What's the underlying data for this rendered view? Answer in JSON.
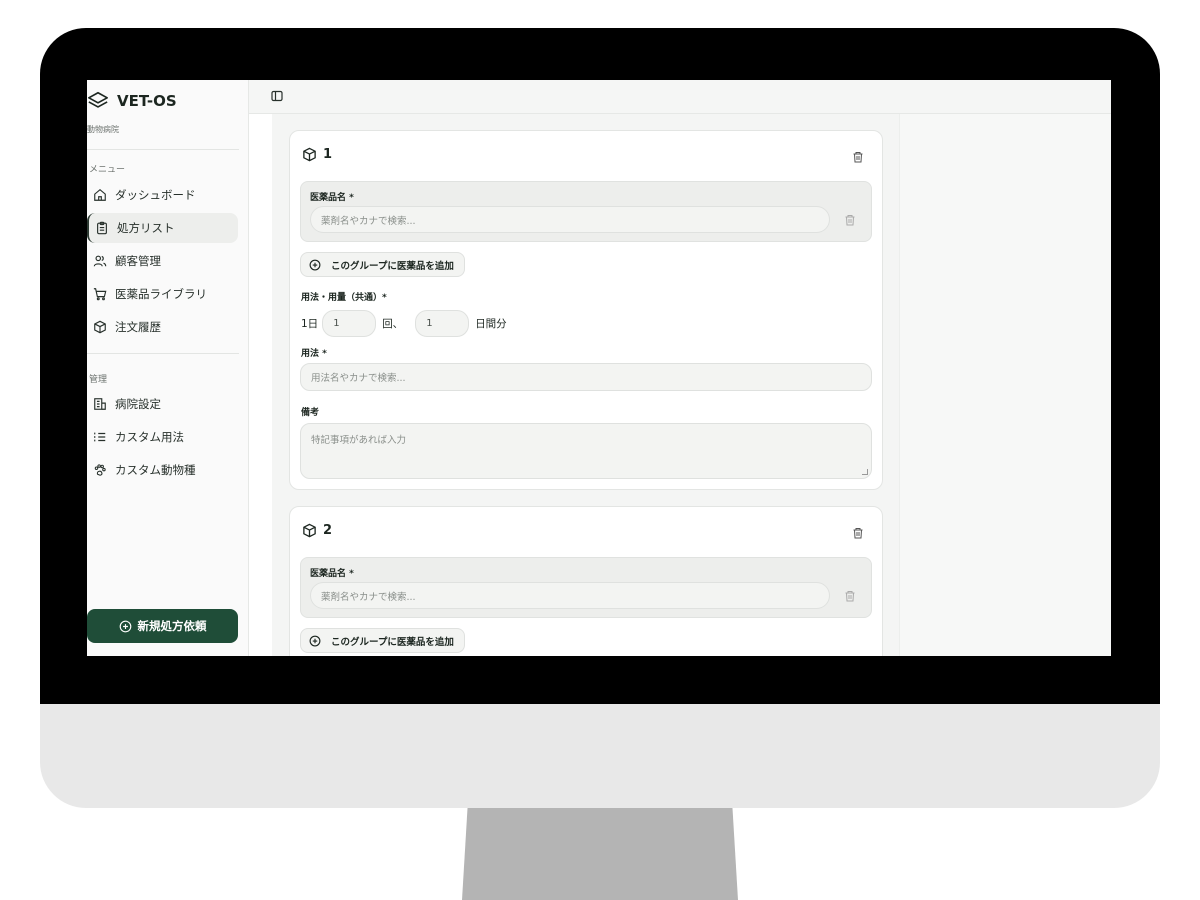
{
  "brand": {
    "name": "VET-OS",
    "subtitle": "動物病院"
  },
  "sidebar": {
    "menu_label": "メニュー",
    "items": [
      {
        "label": "ダッシュボード",
        "icon": "home-icon"
      },
      {
        "label": "処方リスト",
        "icon": "clipboard-icon",
        "active": true
      },
      {
        "label": "顧客管理",
        "icon": "users-icon"
      },
      {
        "label": "医薬品ライブラリ",
        "icon": "cart-icon"
      },
      {
        "label": "注文履歴",
        "icon": "package-icon"
      }
    ],
    "admin_label": "管理",
    "admin_items": [
      {
        "label": "病院設定",
        "icon": "building-icon"
      },
      {
        "label": "カスタム用法",
        "icon": "list-icon"
      },
      {
        "label": "カスタム動物種",
        "icon": "paw-icon"
      }
    ],
    "new_button": "新規処方依頼"
  },
  "groups": [
    {
      "number": "1",
      "med_label": "医薬品名 *",
      "med_placeholder": "薬剤名やカナで検索...",
      "add_label": "このグループに医薬品を追加",
      "dose_label": "用法・用量（共通）*",
      "dose": {
        "prefix": "1日",
        "times": "1",
        "times_unit": "回、",
        "days": "1",
        "days_unit": "日間分"
      },
      "usage_label": "用法 *",
      "usage_placeholder": "用法名やカナで検索...",
      "notes_label": "備考",
      "notes_placeholder": "特記事項があれば入力"
    },
    {
      "number": "2",
      "med_label": "医薬品名 *",
      "med_placeholder": "薬剤名やカナで検索...",
      "add_label": "このグループに医薬品を追加"
    }
  ],
  "colors": {
    "accent": "#1f4d38",
    "background": "#f4f5f4"
  }
}
